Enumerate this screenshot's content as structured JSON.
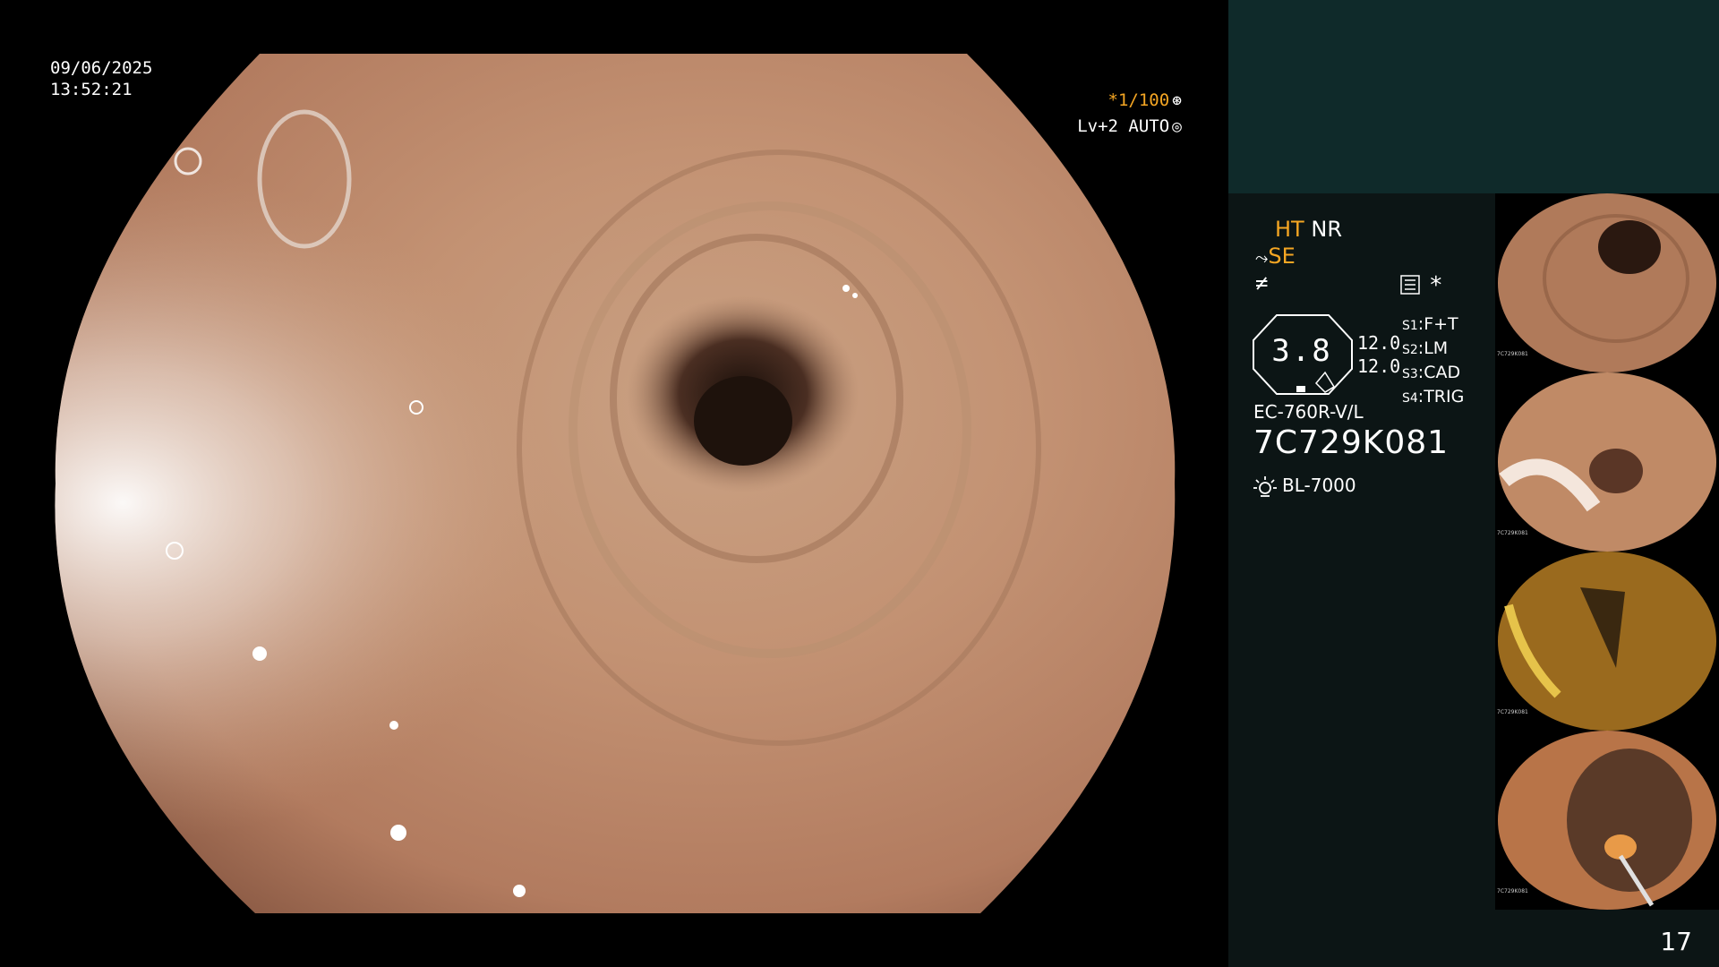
{
  "timestamp": {
    "date": "09/06/2025",
    "time": "13:52:21"
  },
  "indicators": {
    "shutter": "*1/100",
    "level": "Lv+2 AUTO"
  },
  "panel": {
    "ht_label": "HT",
    "nr_label": "NR",
    "se_label": "SE",
    "f_symbol": "≠",
    "star": "*",
    "octa_value": "3.8",
    "values": [
      "12.0",
      "12.0"
    ],
    "slots": [
      {
        "key": "S1",
        "value": "F+T"
      },
      {
        "key": "S2",
        "value": "LM"
      },
      {
        "key": "S3",
        "value": "CAD"
      },
      {
        "key": "S4",
        "value": "TRIG"
      }
    ],
    "model": "EC-760R-V/L",
    "serial": "7C729K081",
    "light_source": "BL-7000"
  },
  "thumbnails": [
    {
      "serial": "7C729K081",
      "tone": "#b07a5a"
    },
    {
      "serial": "7C729K081",
      "tone": "#c08a66"
    },
    {
      "serial": "7C729K081",
      "tone": "#9a6a1e"
    },
    {
      "serial": "7C729K081",
      "tone": "#b87448"
    }
  ],
  "page_number": "17",
  "colors": {
    "accent_orange": "#f5a623",
    "panel_bg": "#0c1515",
    "panel_top": "#0f2a2a"
  }
}
